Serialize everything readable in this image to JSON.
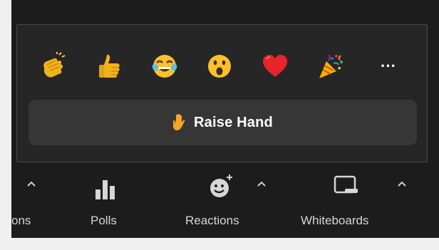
{
  "reactions_popup": {
    "emojis": [
      {
        "name": "clapping-hands",
        "icon": "clap-emoji-icon"
      },
      {
        "name": "thumbs-up",
        "icon": "thumbs-up-emoji-icon"
      },
      {
        "name": "tears-of-joy",
        "icon": "tears-of-joy-emoji-icon"
      },
      {
        "name": "open-mouth",
        "icon": "open-mouth-emoji-icon"
      },
      {
        "name": "red-heart",
        "icon": "heart-emoji-icon"
      },
      {
        "name": "party-popper",
        "icon": "party-popper-emoji-icon"
      }
    ],
    "more_label": "···",
    "raise_hand": {
      "label": "Raise Hand",
      "icon": "raised-hand-icon"
    }
  },
  "toolbar": {
    "partial_label": "ons",
    "polls_label": "Polls",
    "reactions_label": "Reactions",
    "whiteboards_label": "Whiteboards",
    "caret": "^"
  },
  "colors": {
    "background": "#1c1c1c",
    "popup": "#262626",
    "button": "#363636",
    "text": "#d6d6d6"
  }
}
